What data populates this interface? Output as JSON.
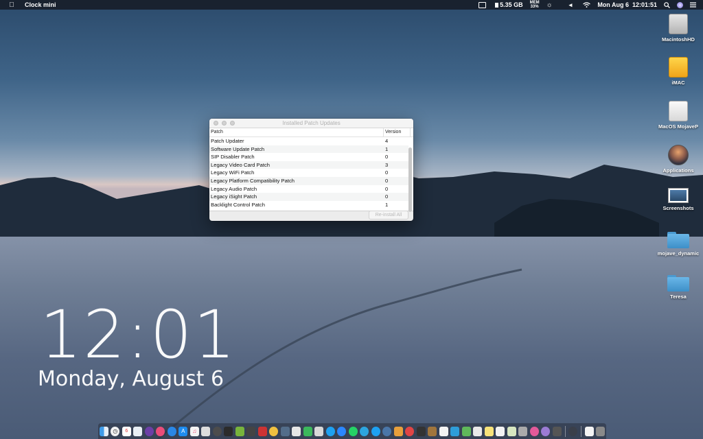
{
  "menubar": {
    "apple_icon": "apple-icon",
    "app_name": "Clock mini",
    "disk_free": "5.35 GB",
    "mem_label": "MEM",
    "mem_percent": "33%",
    "datetime": "Mon Aug 6  12:01:51"
  },
  "window": {
    "title": "Installed Patch Updates",
    "columns": {
      "patch": "Patch",
      "version": "Version"
    },
    "rows": [
      {
        "patch": "Patch Updater",
        "version": "4"
      },
      {
        "patch": "Software Update Patch",
        "version": "1"
      },
      {
        "patch": "SIP Disabler Patch",
        "version": "0"
      },
      {
        "patch": "Legacy Video Card Patch",
        "version": "3"
      },
      {
        "patch": "Legacy WiFi Patch",
        "version": "0"
      },
      {
        "patch": "Legacy Platform Compatibility Patch",
        "version": "0"
      },
      {
        "patch": "Legacy Audio Patch",
        "version": "0"
      },
      {
        "patch": "Legacy iSight Patch",
        "version": "0"
      },
      {
        "patch": "Backlight Control Patch",
        "version": "1"
      }
    ],
    "reinstall_label": "Re-install All"
  },
  "desktop_icons": [
    {
      "label": "MacintoshHD",
      "icon": "hard-drive-icon"
    },
    {
      "label": "iMAC",
      "icon": "external-drive-icon"
    },
    {
      "label": "MacOS MojaveP",
      "icon": "drive-icon"
    },
    {
      "label": "Applications",
      "icon": "applications-icon"
    },
    {
      "label": "Screenshots",
      "icon": "screenshot-icon"
    },
    {
      "label": "mojave_dynamic",
      "icon": "folder-icon"
    },
    {
      "label": "Teresa",
      "icon": "folder-icon"
    }
  ],
  "clock_widget": {
    "time": "12:01",
    "date": "Monday, August 6"
  },
  "colors": {
    "menubar": "#181e2a",
    "folder": "#4a9ad1",
    "drive_yellow": "#ffd54a"
  }
}
